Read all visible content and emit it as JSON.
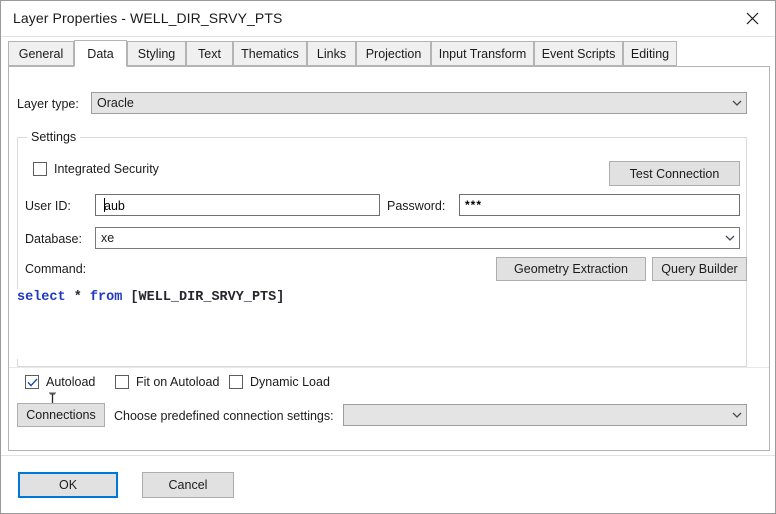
{
  "window": {
    "title": "Layer Properties - WELL_DIR_SRVY_PTS",
    "close_label": "×"
  },
  "tabs": [
    {
      "label": "General",
      "active": false
    },
    {
      "label": "Data",
      "active": true
    },
    {
      "label": "Styling",
      "active": false
    },
    {
      "label": "Text",
      "active": false
    },
    {
      "label": "Thematics",
      "active": false
    },
    {
      "label": "Links",
      "active": false
    },
    {
      "label": "Projection",
      "active": false
    },
    {
      "label": "Input Transform",
      "active": false
    },
    {
      "label": "Event Scripts",
      "active": false
    },
    {
      "label": "Editing",
      "active": false
    }
  ],
  "layer_type": {
    "label": "Layer type:",
    "value": "Oracle"
  },
  "settings": {
    "group_title": "Settings",
    "integrated_security": {
      "label": "Integrated Security",
      "checked": false
    },
    "test_connection_label": "Test Connection",
    "user_id": {
      "label": "User ID:",
      "value": "aub",
      "placeholder": ""
    },
    "password": {
      "label": "Password:",
      "value": "***",
      "placeholder": ""
    },
    "database": {
      "label": "Database:",
      "value": "xe",
      "placeholder": ""
    },
    "command": {
      "label": "Command:",
      "geometry_extraction_label": "Geometry Extraction",
      "query_builder_label": "Query Builder",
      "sql": {
        "keyword1": "select",
        "star": " * ",
        "keyword2": "from",
        "table": " [WELL_DIR_SRVY_PTS]"
      }
    }
  },
  "options": {
    "autoload": {
      "label": "Autoload",
      "checked": true
    },
    "fit_on_autoload": {
      "label": "Fit on Autoload",
      "checked": false
    },
    "dynamic_load": {
      "label": "Dynamic Load",
      "checked": false
    }
  },
  "connections": {
    "button_label": "Connections",
    "choose_label": "Choose predefined connection settings:",
    "selected": ""
  },
  "footer": {
    "ok_label": "OK",
    "cancel_label": "Cancel"
  },
  "colors": {
    "accent": "#0078d7",
    "sql_keyword": "#1f38c4",
    "sql_text": "#26262e",
    "check_mark": "#1b4f9e"
  }
}
